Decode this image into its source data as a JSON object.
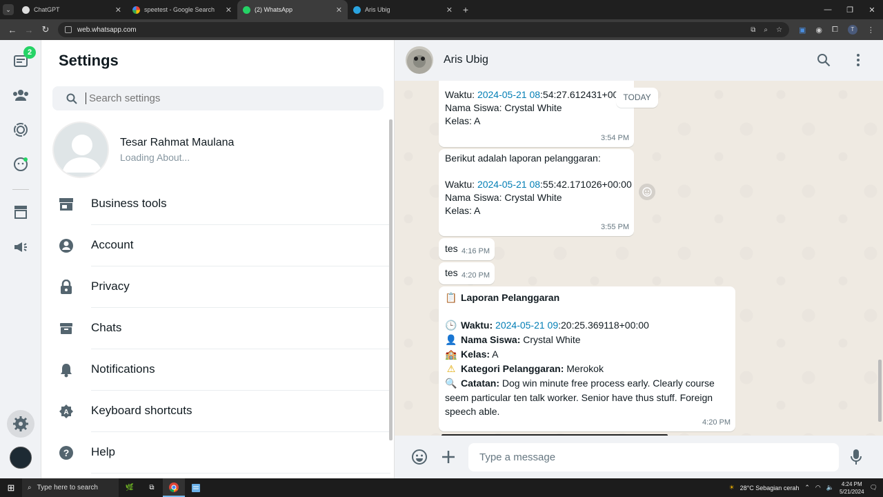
{
  "browser": {
    "tabs": [
      {
        "title": "ChatGPT",
        "color": "#ffffff"
      },
      {
        "title": "speetest - Google Search",
        "color": "#4285f4"
      },
      {
        "title": "(2) WhatsApp",
        "color": "#25d366"
      },
      {
        "title": "Aris Ubig",
        "color": "#2aa3df"
      }
    ],
    "url": "web.whatsapp.com",
    "profile_initial": "T"
  },
  "rail": {
    "badge": "2"
  },
  "settings": {
    "title": "Settings",
    "search_placeholder": "Search settings",
    "profile_name": "Tesar Rahmat Maulana",
    "profile_about": "Loading About...",
    "items": [
      {
        "label": "Business tools",
        "icon": "store-icon"
      },
      {
        "label": "Account",
        "icon": "account-icon"
      },
      {
        "label": "Privacy",
        "icon": "lock-icon"
      },
      {
        "label": "Chats",
        "icon": "chat-archive-icon"
      },
      {
        "label": "Notifications",
        "icon": "bell-icon"
      },
      {
        "label": "Keyboard shortcuts",
        "icon": "keyboard-icon"
      },
      {
        "label": "Help",
        "icon": "help-icon"
      }
    ]
  },
  "chat": {
    "contact_name": "Aris Ubig",
    "date_chip": "TODAY",
    "msg1": {
      "waktu_label": "Waktu: ",
      "waktu_link": "2024-05-21 08",
      "waktu_rest": ":54:27.612431+00:00",
      "siswa": "Nama Siswa: Crystal White",
      "kelas": "Kelas: A",
      "time": "3:54 PM"
    },
    "msg2": {
      "intro": "Berikut adalah laporan pelanggaran:",
      "waktu_label": "Waktu: ",
      "waktu_link": "2024-05-21 08",
      "waktu_rest": ":55:42.171026+00:00",
      "siswa": "Nama Siswa: Crystal White",
      "kelas": "Kelas: A",
      "time": "3:55 PM"
    },
    "msg3": {
      "text": "tes",
      "time": "4:16 PM"
    },
    "msg4": {
      "text": "tes",
      "time": "4:20 PM"
    },
    "msg5": {
      "title": "Laporan Pelanggaran",
      "waktu_label": "Waktu:",
      "waktu_link": "2024-05-21 09",
      "waktu_rest": ":20:25.369118+00:00",
      "siswa_label": "Nama Siswa:",
      "siswa_value": "Crystal White",
      "kelas_label": "Kelas:",
      "kelas_value": "A",
      "kategori_label": "Kategori Pelanggaran:",
      "kategori_value": "Merokok",
      "catatan_label": "Catatan:",
      "catatan_value": "Dog win minute free process early. Clearly course seem particular ten talk worker. Senior have thus stuff. Foreign speech able.",
      "time": "4:20 PM"
    },
    "composer_placeholder": "Type a message"
  },
  "taskbar": {
    "search_placeholder": "Type here to search",
    "weather": "28°C  Sebagian cerah",
    "time": "4:24 PM",
    "date": "5/21/2024"
  },
  "colors": {
    "accent": "#25d366",
    "link": "#027eb5",
    "chat_bg": "#efeae2"
  }
}
